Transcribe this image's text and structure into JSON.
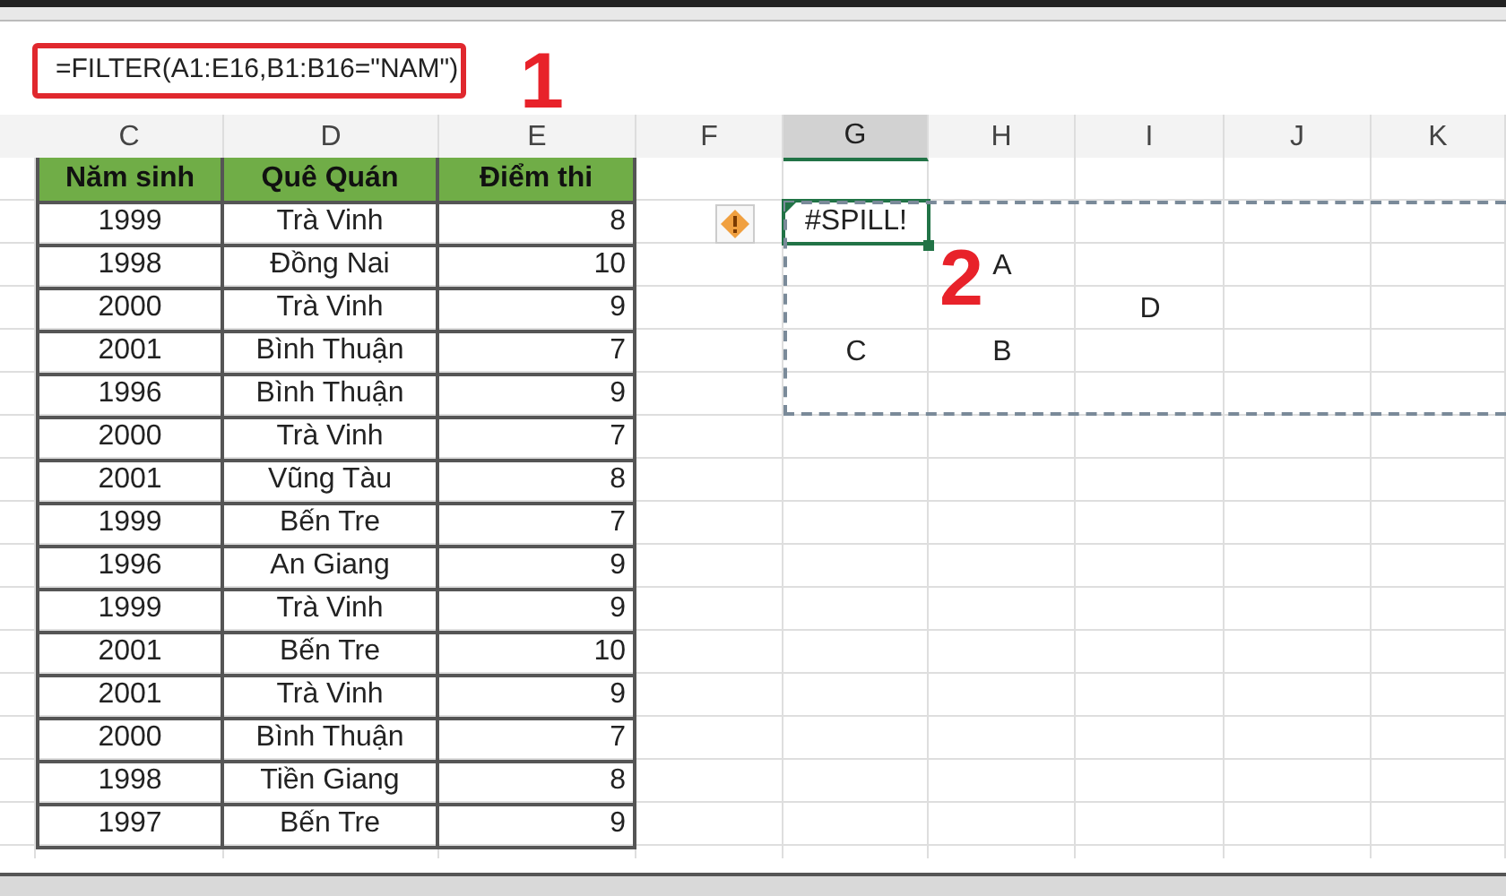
{
  "formula_bar": {
    "formula": "=FILTER(A1:E16,B1:B16=\"NAM\")"
  },
  "annotations": [
    {
      "text": "1"
    },
    {
      "text": "2"
    }
  ],
  "columns": [
    {
      "label": "C",
      "selected": false
    },
    {
      "label": "D",
      "selected": false
    },
    {
      "label": "E",
      "selected": false
    },
    {
      "label": "F",
      "selected": false
    },
    {
      "label": "G",
      "selected": true
    },
    {
      "label": "H",
      "selected": false
    },
    {
      "label": "I",
      "selected": false
    },
    {
      "label": "J",
      "selected": false
    },
    {
      "label": "K",
      "selected": false
    }
  ],
  "table": {
    "headers": [
      "Năm sinh",
      "Quê Quán",
      "Điểm thi"
    ],
    "rows": [
      [
        "1999",
        "Trà Vinh",
        "8"
      ],
      [
        "1998",
        "Đồng Nai",
        "10"
      ],
      [
        "2000",
        "Trà Vinh",
        "9"
      ],
      [
        "2001",
        "Bình Thuận",
        "7"
      ],
      [
        "1996",
        "Bình Thuận",
        "9"
      ],
      [
        "2000",
        "Trà Vinh",
        "7"
      ],
      [
        "2001",
        "Vũng Tàu",
        "8"
      ],
      [
        "1999",
        "Bến Tre",
        "7"
      ],
      [
        "1996",
        "An Giang",
        "9"
      ],
      [
        "1999",
        "Trà Vinh",
        "9"
      ],
      [
        "2001",
        "Bến Tre",
        "10"
      ],
      [
        "2001",
        "Trà Vinh",
        "9"
      ],
      [
        "2000",
        "Bình Thuận",
        "7"
      ],
      [
        "1998",
        "Tiền Giang",
        "8"
      ],
      [
        "1997",
        "Bến Tre",
        "9"
      ]
    ]
  },
  "spill": {
    "rows": [
      {
        "G": "#SPILL!"
      },
      {
        "H": "A"
      },
      {
        "I": "D"
      },
      {
        "G": "C",
        "H": "B"
      }
    ]
  }
}
